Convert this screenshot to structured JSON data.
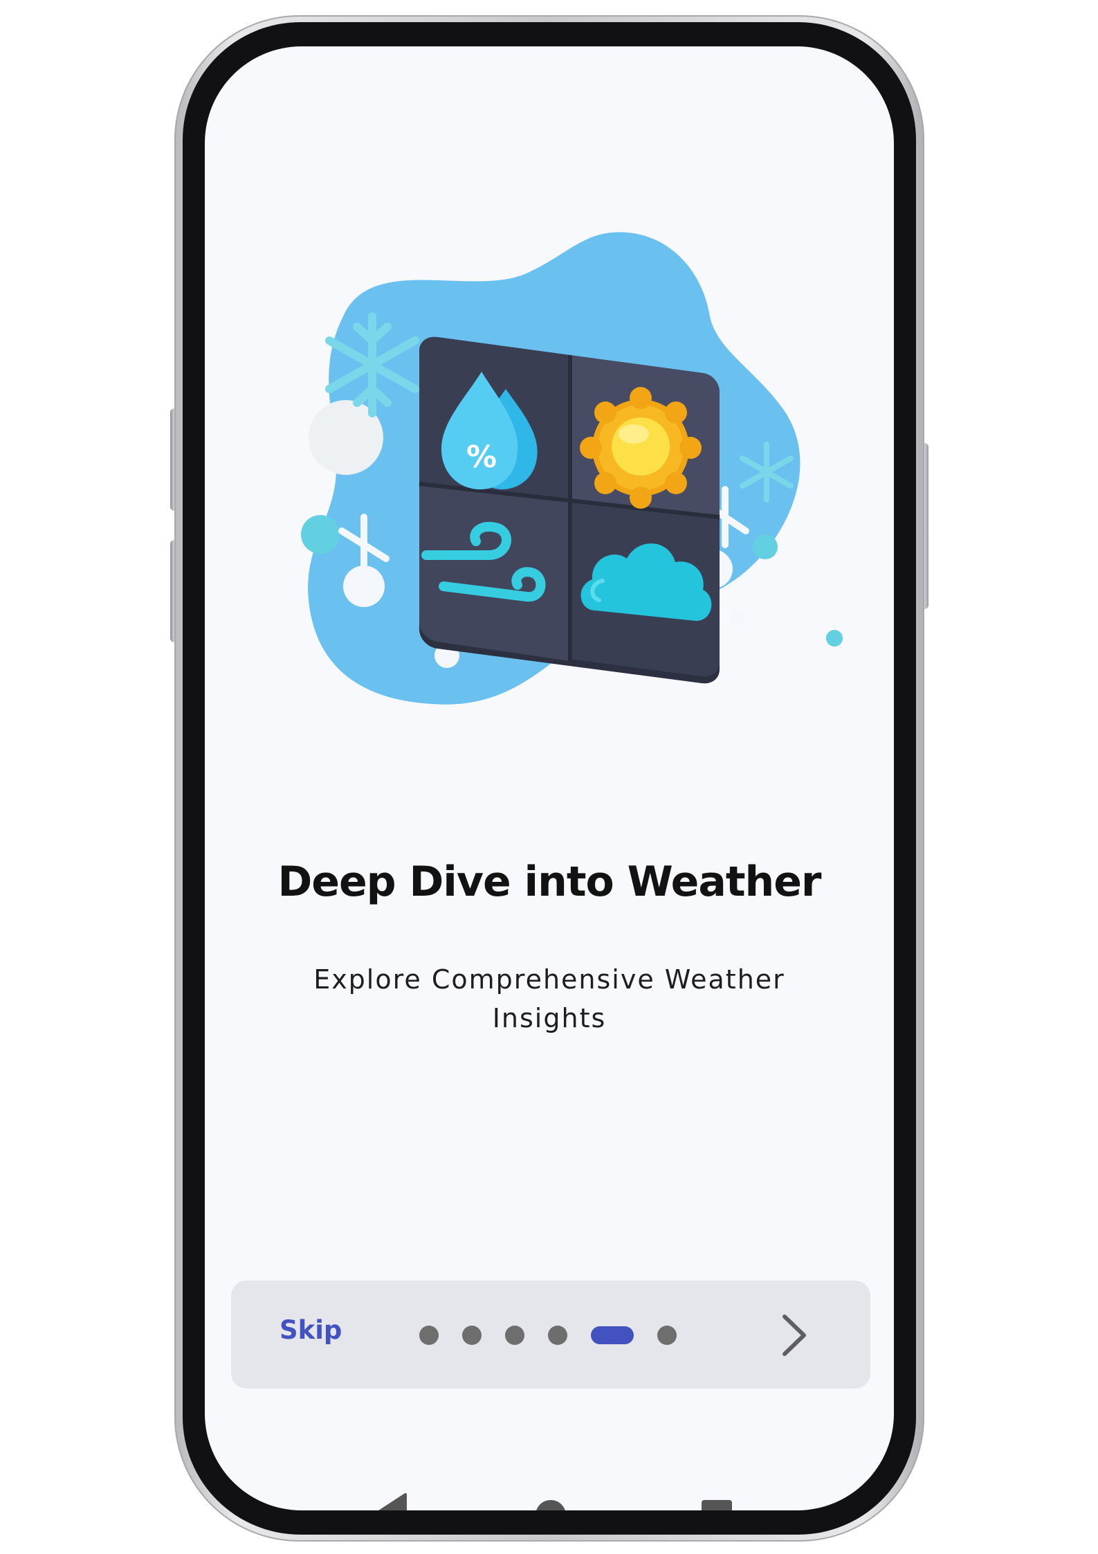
{
  "onboarding": {
    "title": "Deep Dive into Weather",
    "subtitle": "Explore Comprehensive Weather Insights",
    "skip_label": "Skip",
    "pager": {
      "page_count": 6,
      "active_index": 4
    }
  },
  "illustration": {
    "tiles": [
      "humidity-drop-icon",
      "sun-icon",
      "wind-icon",
      "cloud-icon"
    ],
    "humidity_symbol": "%"
  },
  "icons": {
    "next": "chevron-right-icon",
    "nav_back": "back-triangle-icon",
    "nav_home": "home-circle-icon",
    "nav_recents": "recents-square-icon"
  },
  "colors": {
    "accent": "#4253bf",
    "screen_background": "#f7f9fd",
    "bottom_bar": "#e4e6eb",
    "blob": "#6ac1ef",
    "dot_inactive": "#6e6e6e"
  }
}
